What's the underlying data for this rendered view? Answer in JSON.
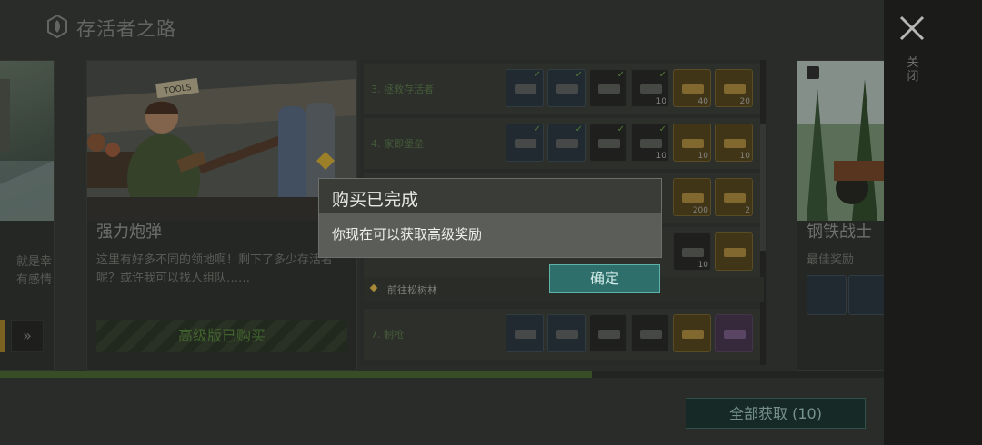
{
  "header": {
    "title": "存活者之路",
    "close_label": "关闭"
  },
  "cards": {
    "left_partial": {
      "desc": "就是幸\n有感情"
    },
    "center": {
      "name": "强力炮弹",
      "desc": "这里有好多不同的领地啊！剩下了多少存活者呢？或许我可以找人组队……",
      "bought_label": "高级版已购买",
      "sign_text": "TOOLS"
    },
    "right_partial": {
      "name": "钢铁战士",
      "reward_label": "最佳奖励"
    }
  },
  "missions": {
    "rows": [
      {
        "label": "3. 拯救存活者",
        "slots": [
          {
            "type": "blue",
            "icon": "rifle-icon",
            "check": true
          },
          {
            "type": "blue",
            "icon": "crate-icon",
            "check": true
          },
          {
            "type": "dark",
            "icon": "pistol-icon",
            "check": true
          },
          {
            "type": "dark",
            "icon": "tires-icon",
            "count": "10",
            "check": true
          },
          {
            "type": "gold",
            "icon": "wood-plank-icon",
            "count": "40"
          },
          {
            "type": "gold",
            "icon": "metal-bar-icon",
            "count": "20"
          }
        ]
      },
      {
        "label": "4. 家即堡垒",
        "slots": [
          {
            "type": "blue",
            "icon": "rifle-icon",
            "check": true
          },
          {
            "type": "blue",
            "icon": "workbench-icon",
            "check": true
          },
          {
            "type": "dark",
            "icon": "cabinet-icon",
            "check": true
          },
          {
            "type": "dark",
            "icon": "bottle-icon",
            "count": "10",
            "check": true
          },
          {
            "type": "gold",
            "icon": "revolver-icon",
            "count": "10"
          },
          {
            "type": "gold",
            "icon": "medkit-icon",
            "count": "10"
          }
        ]
      },
      {
        "label": "",
        "slots": [
          {
            "type": "gold",
            "icon": "bottlecap-icon",
            "count": "200"
          },
          {
            "type": "gold",
            "icon": "pill-bottle-icon",
            "count": "2"
          }
        ]
      },
      {
        "label": "",
        "slots": [
          {
            "type": "dark",
            "icon": "parts-icon",
            "count": "10"
          },
          {
            "type": "gold",
            "icon": "backpack-icon"
          }
        ]
      },
      {
        "label": "7. 制枪",
        "slots": [
          {
            "type": "blue",
            "icon": "frame-icon"
          },
          {
            "type": "blue",
            "icon": "plank-icon"
          },
          {
            "type": "dark",
            "icon": "machete-icon"
          },
          {
            "type": "dark",
            "icon": "blade-icon"
          },
          {
            "type": "gold",
            "icon": "ak-rifle-icon"
          },
          {
            "type": "purple",
            "icon": "stick-icon"
          }
        ]
      }
    ],
    "goto_label": "前往松树林"
  },
  "progress": {
    "fraction": 0.67
  },
  "claim_all": {
    "label": "全部获取 (10)"
  },
  "modal": {
    "title": "购买已完成",
    "message": "你现在可以获取高级奖励",
    "ok_label": "确定"
  },
  "colors": {
    "accent_teal": "#2e6f6b",
    "progress_green": "#4c6b35",
    "gold_slot": "#5a4a22"
  }
}
